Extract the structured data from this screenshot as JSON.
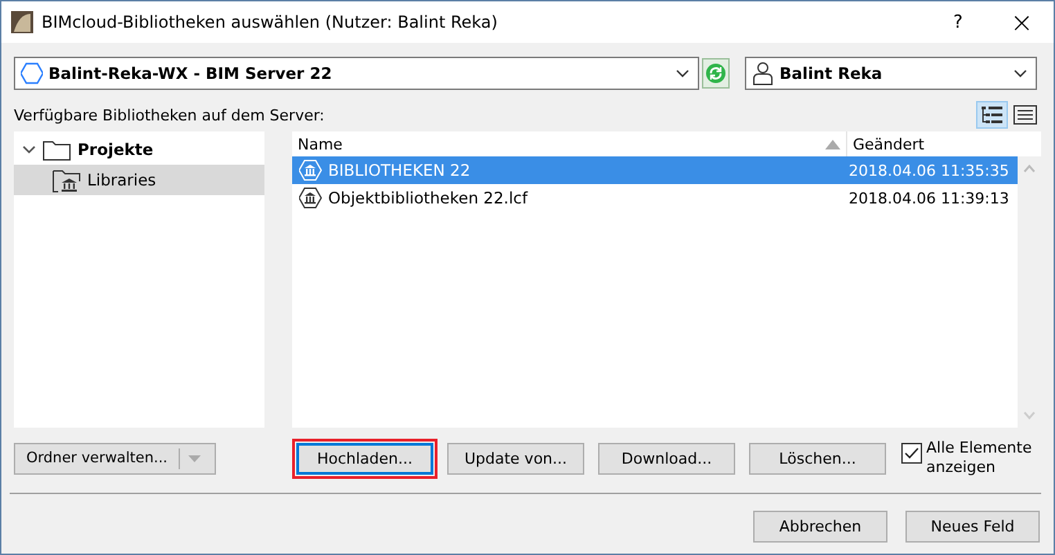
{
  "window": {
    "title": "BIMcloud-Bibliotheken auswählen (Nutzer: Balint Reka)",
    "help": "?",
    "close": "×"
  },
  "server": {
    "value": "Balint-Reka-WX - BIM Server 22"
  },
  "user": {
    "value": "Balint Reka"
  },
  "list_label": "Verfügbare Bibliotheken auf dem Server:",
  "view_modes": [
    {
      "kind": "tree",
      "selected": true
    },
    {
      "kind": "list",
      "selected": false
    }
  ],
  "tree": [
    {
      "label": "Projekte",
      "expanded": true,
      "selected": false,
      "children": [
        {
          "label": "Libraries",
          "selected": true
        }
      ]
    }
  ],
  "table": {
    "columns": [
      "Name",
      "Geändert"
    ],
    "rows": [
      {
        "name": "BIBLIOTHEKEN 22",
        "changed": "2018.04.06 11:35:35",
        "selected": true
      },
      {
        "name": "Objektbibliotheken 22.lcf",
        "changed": "2018.04.06 11:39:13",
        "selected": false
      }
    ]
  },
  "folder_button": "Ordner verwalten...",
  "actions": [
    {
      "label": "Hochladen...",
      "focused": true,
      "highlighted": true
    },
    {
      "label": "Update von...",
      "focused": false,
      "highlighted": false
    },
    {
      "label": "Download...",
      "focused": false,
      "highlighted": false
    },
    {
      "label": "Löschen...",
      "focused": false,
      "highlighted": false
    }
  ],
  "show_all": {
    "label": "Alle Elemente anzeigen",
    "checked": true
  },
  "footer_buttons": [
    "Abbrechen",
    "Neues Feld"
  ]
}
